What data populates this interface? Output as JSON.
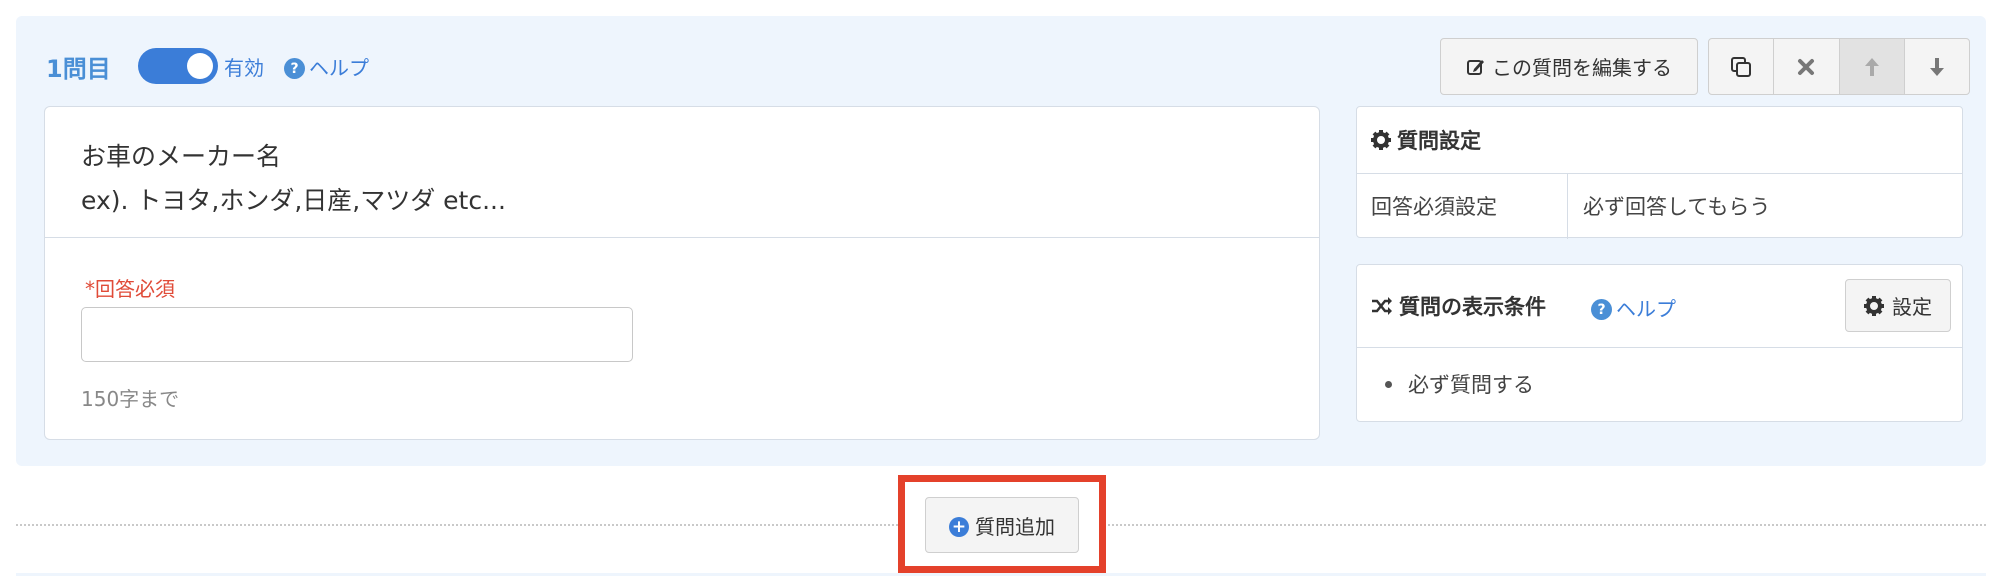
{
  "question": {
    "number_label": "1問目",
    "toggle": {
      "state": "on",
      "label": "有効"
    },
    "help_label": "ヘルプ",
    "title_line1": "お車のメーカー名",
    "title_line2": "ex). トヨタ,ホンダ,日産,マツダ etc...",
    "required_label": "*回答必須",
    "input_value": "",
    "char_limit": "150字まで"
  },
  "toolbar": {
    "edit_label": "この質問を編集する",
    "copy_icon": "copy-icon",
    "delete_icon": "close-icon",
    "move_up_icon": "arrow-up-icon",
    "move_down_icon": "arrow-down-icon"
  },
  "settings_panel": {
    "title": "質問設定",
    "icon": "gear-icon",
    "row_label": "回答必須設定",
    "row_value": "必ず回答してもらう"
  },
  "conditions_panel": {
    "title": "質問の表示条件",
    "icon": "shuffle-icon",
    "help_label": "ヘルプ",
    "settings_button": "設定",
    "items": [
      "必ず質問する"
    ]
  },
  "add_question_label": "質問追加",
  "colors": {
    "accent": "#3b7dd8",
    "card_bg": "#eef5fd",
    "required": "#e04b38",
    "highlight": "#e4412b"
  }
}
